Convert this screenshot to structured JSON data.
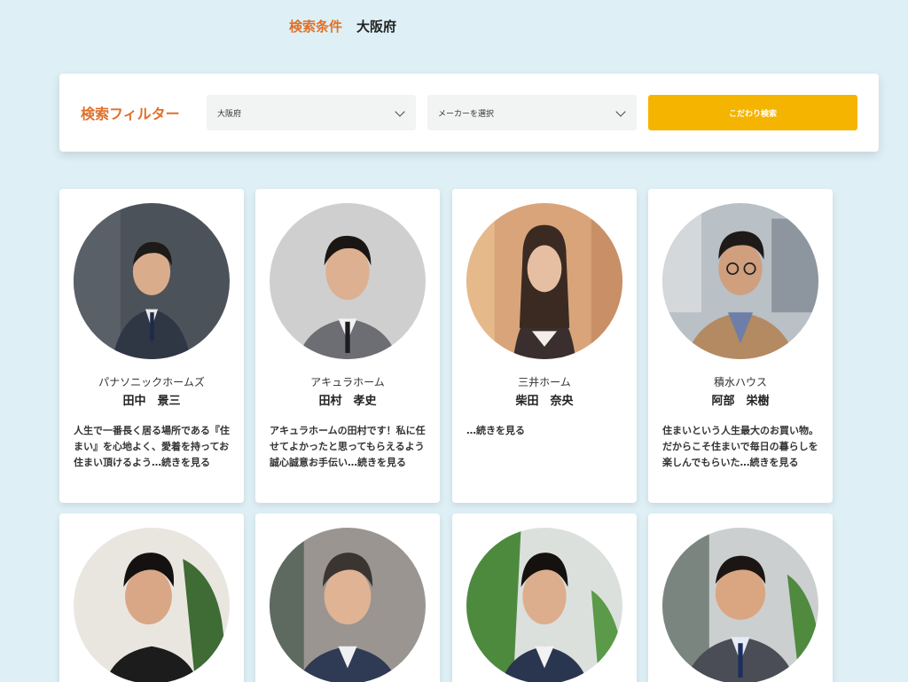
{
  "search_condition": {
    "label": "検索条件",
    "value": "大阪府"
  },
  "filter": {
    "title": "検索フィルター",
    "prefecture_selected": "大阪府",
    "maker_placeholder": "メーカーを選択",
    "search_button": "こだわり検索"
  },
  "colors": {
    "accent_orange": "#e0702a",
    "button_yellow": "#f5b400",
    "background": "#def0f6"
  },
  "staff": [
    {
      "maker": "パナソニックホームズ",
      "name": "田中　景三",
      "desc": "人生で一番長く居る場所である『住まい』を心地よく、愛着を持ってお住まい頂けるよう…続きを見る"
    },
    {
      "maker": "アキュラホーム",
      "name": "田村　孝史",
      "desc": "アキュラホームの田村です！私に任せてよかったと思ってもらえるよう誠心誠意お手伝い…続きを見る"
    },
    {
      "maker": "三井ホーム",
      "name": "柴田　奈央",
      "desc": "…続きを見る"
    },
    {
      "maker": "積水ハウス",
      "name": "阿部　栄樹",
      "desc": "住まいという人生最大のお買い物。だからこそ住まいで毎日の暮らしを楽しんでもらいた…続きを見る"
    },
    {
      "maker": "",
      "name": "",
      "desc": ""
    },
    {
      "maker": "",
      "name": "",
      "desc": ""
    },
    {
      "maker": "",
      "name": "",
      "desc": ""
    },
    {
      "maker": "",
      "name": "",
      "desc": ""
    }
  ]
}
